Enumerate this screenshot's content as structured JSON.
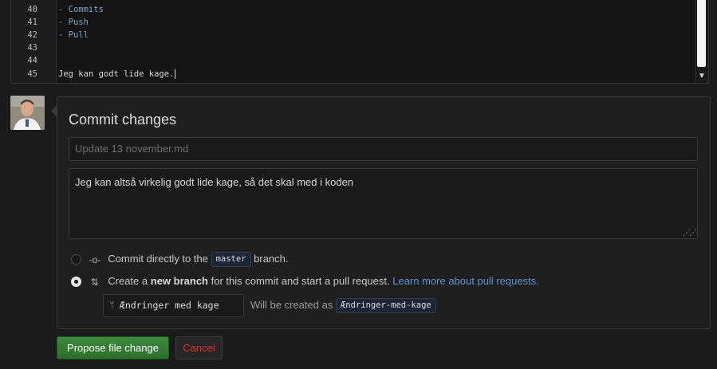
{
  "editor": {
    "lines": [
      {
        "num": "40",
        "text": "- Commits",
        "style": "md"
      },
      {
        "num": "41",
        "text": "- Push",
        "style": "md"
      },
      {
        "num": "42",
        "text": "- Pull",
        "style": "md"
      },
      {
        "num": "43",
        "text": "",
        "style": "md"
      },
      {
        "num": "44",
        "text": "",
        "style": "md"
      },
      {
        "num": "45",
        "text": "Jeg kan godt lide kage.",
        "style": "plain"
      }
    ]
  },
  "commit": {
    "title": "Commit changes",
    "summary_placeholder": "Update 13 november.md",
    "description": "Jeg kan altså virkelig godt lide kage, så det skal med i koden",
    "option_direct": {
      "prefix": "Commit directly to the",
      "branch": "master",
      "suffix": "branch."
    },
    "option_new": {
      "prefix": "Create a",
      "bold": "new branch",
      "middle": "for this commit and start a pull request.",
      "link": "Learn more about pull requests."
    },
    "branch_name_value": "Ændringer med kage",
    "will_be_created": "Will be created as",
    "branch_slug": "Ændringer-med-kage"
  },
  "buttons": {
    "propose": "Propose file change",
    "cancel": "Cancel"
  },
  "icons": {
    "commit": "git-commit-icon",
    "pull_request": "git-pull-request-icon",
    "branch": "git-branch-icon"
  },
  "colors": {
    "propose_button": "#2c6e2c",
    "cancel_text": "#e0332b",
    "link": "#5a93d6"
  }
}
